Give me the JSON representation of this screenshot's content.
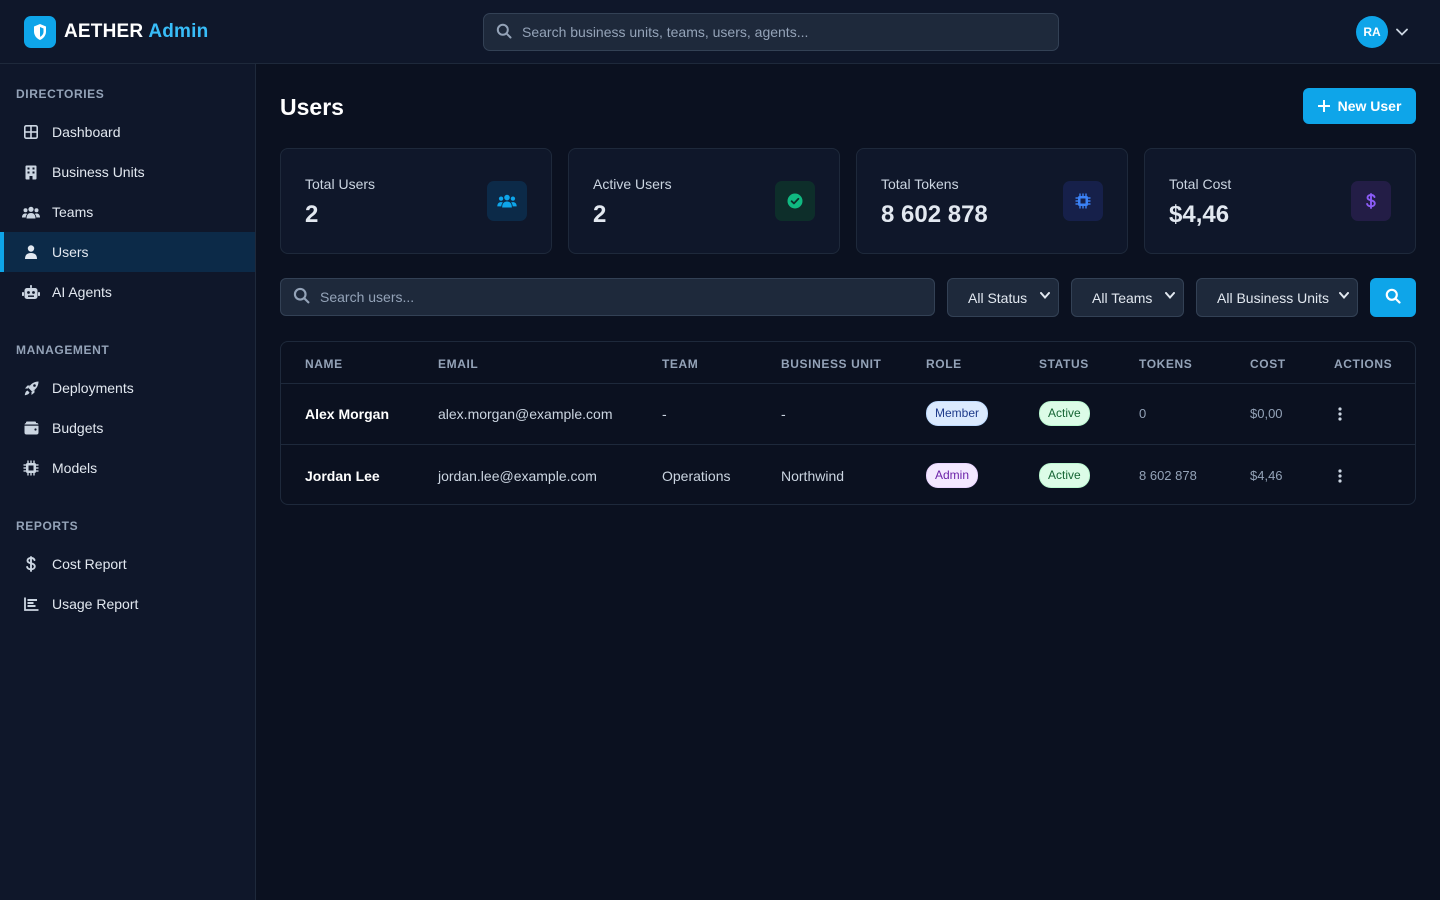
{
  "app": {
    "brand": "AETHER",
    "brand_accent": "Admin",
    "search_placeholder": "Search business units, teams, users, agents...",
    "user_initials": "RA"
  },
  "sidebar": {
    "sections": [
      {
        "title": "DIRECTORIES",
        "items": [
          {
            "label": "Dashboard",
            "icon": "dashboard-icon"
          },
          {
            "label": "Business Units",
            "icon": "building-icon"
          },
          {
            "label": "Teams",
            "icon": "users-group-icon"
          },
          {
            "label": "Users",
            "icon": "user-icon",
            "active": true
          },
          {
            "label": "AI Agents",
            "icon": "robot-icon"
          }
        ]
      },
      {
        "title": "MANAGEMENT",
        "items": [
          {
            "label": "Deployments",
            "icon": "rocket-icon"
          },
          {
            "label": "Budgets",
            "icon": "wallet-icon"
          },
          {
            "label": "Models",
            "icon": "chip-icon"
          }
        ]
      },
      {
        "title": "REPORTS",
        "items": [
          {
            "label": "Cost Report",
            "icon": "dollar-icon"
          },
          {
            "label": "Usage Report",
            "icon": "bar-chart-icon"
          }
        ]
      }
    ]
  },
  "page": {
    "title": "Users",
    "new_button": "New User"
  },
  "stats": [
    {
      "label": "Total Users",
      "value": "2",
      "icon": "users-group-icon"
    },
    {
      "label": "Active Users",
      "value": "2",
      "icon": "check-circle-icon"
    },
    {
      "label": "Total Tokens",
      "value": "8 602 878",
      "icon": "chip-icon"
    },
    {
      "label": "Total Cost",
      "value": "$4,46",
      "icon": "dollar-icon"
    }
  ],
  "filters": {
    "search_placeholder": "Search users...",
    "status": "All Status",
    "teams": "All Teams",
    "business_units": "All Business Units"
  },
  "table": {
    "headers": [
      "NAME",
      "EMAIL",
      "TEAM",
      "BUSINESS UNIT",
      "ROLE",
      "STATUS",
      "TOKENS",
      "COST",
      "ACTIONS"
    ],
    "rows": [
      {
        "name": "Alex Morgan",
        "email": "alex.morgan@example.com",
        "team": "-",
        "business_unit": "-",
        "role": "Member",
        "status": "Active",
        "tokens": "0",
        "cost": "$0,00"
      },
      {
        "name": "Jordan Lee",
        "email": "jordan.lee@example.com",
        "team": "Operations",
        "business_unit": "Northwind",
        "role": "Admin",
        "status": "Active",
        "tokens": "8 602 878",
        "cost": "$4,46"
      }
    ]
  },
  "colors": {
    "accent": "#0ea5e9",
    "background": "#0b1120",
    "panel": "#0f172a"
  }
}
